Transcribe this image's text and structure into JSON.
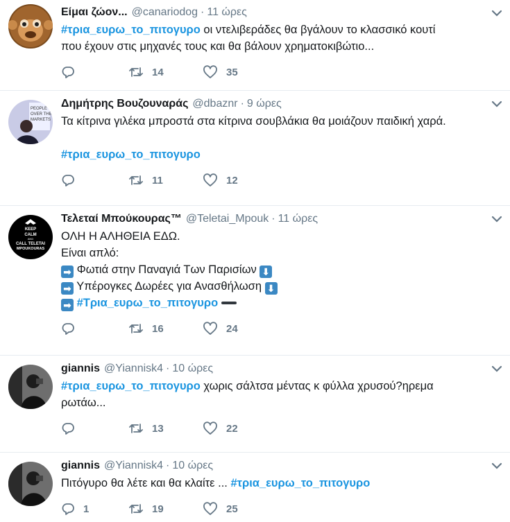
{
  "tweets": [
    {
      "name": "Είμαι ζώον...",
      "handle": "@canariodog",
      "sep": "·",
      "time": "11 ώρες",
      "line1_tag": "#τρια_ευρω_το_πιτογυρο",
      "line1_text": " οι ντελιβεράδες θα βγάλουν  το κλασσικό κουτί",
      "line2": "που έχουν στις μηχανές τους και θα βάλουν χρηματοκιβώτιο...",
      "replies": "",
      "retweets": "14",
      "likes": "35"
    },
    {
      "name": "Δημήτρης Βουζουναράς",
      "handle": "@dbaznr",
      "sep": "·",
      "time": "9 ώρες",
      "line1": "Τα κίτρινα γιλέκα μπροστά στα κίτρινα σουβλάκια θα μοιάζουν παιδική χαρά.",
      "tag": "#τρια_ευρω_το_πιτογυρο",
      "avatar_lines": [
        "PEOPLE",
        "OVER THE",
        "MARKETS"
      ],
      "replies": "",
      "retweets": "11",
      "likes": "12"
    },
    {
      "name": "Τελεταί Μπούκουρας™",
      "handle": "@Teletai_Mpouk",
      "sep": "·",
      "time": "11 ώρες",
      "line1": "ΟΛΗ Η ΑΛΗΘΕΙΑ ΕΔΩ.",
      "line2": "Είναι απλό:",
      "item1": "Φωτιά στην Παναγιά Των Παρισίων",
      "item2": "Υπέρογκες Δωρέες για Ανασθήλωση",
      "item3_tag": "#Τρια_ευρω_το_πιτογυρο",
      "arrow_right": "➡",
      "arrow_down": "⬇",
      "avatar_lines": [
        "KEEP",
        "CALM",
        "AND",
        "CALL TELETAI",
        "MPOUKOURAS"
      ],
      "replies": "",
      "retweets": "16",
      "likes": "24"
    },
    {
      "name": "giannis",
      "handle": "@Yiannisk4",
      "sep": "·",
      "time": "10 ώρες",
      "line1_tag": "#τρια_ευρω_το_πιτογυρο",
      "line1_text": " χωρις σάλτσα μέντας κ φύλλα χρυσού?ηρεμα",
      "line2": "ρωτάω...",
      "replies": "",
      "retweets": "13",
      "likes": "22"
    },
    {
      "name": "giannis",
      "handle": "@Yiannisk4",
      "sep": "·",
      "time": "10 ώρες",
      "line1_text": "Πιτόγυρο θα λέτε και θα κλαίτε ... ",
      "line1_tag": "#τρια_ευρω_το_πιτογυρο",
      "replies": "1",
      "retweets": "19",
      "likes": "25"
    }
  ],
  "icons": {
    "reply": "reply-icon",
    "retweet": "retweet-icon",
    "like": "heart-icon",
    "caret": "chevron-down-icon"
  },
  "colors": {
    "hashtag": "#1b95e0",
    "secondary_text": "#657786",
    "divider": "#e6ecf0"
  }
}
